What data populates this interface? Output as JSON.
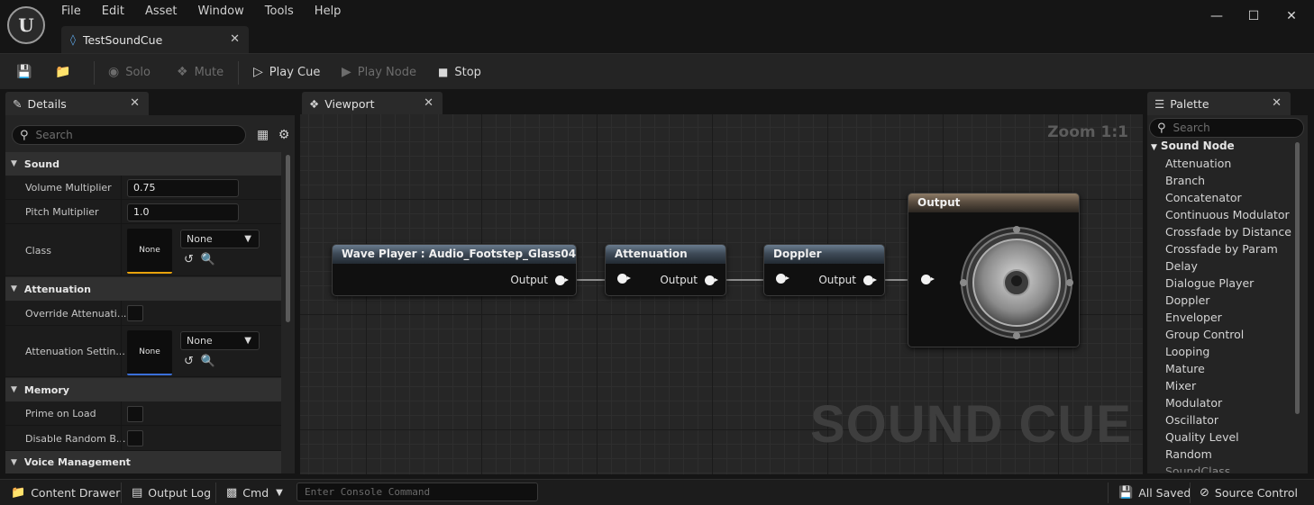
{
  "app": {
    "logo_text": "U",
    "menu": [
      "File",
      "Edit",
      "Asset",
      "Window",
      "Tools",
      "Help"
    ],
    "document_tab": "TestSoundCue"
  },
  "toolbar": {
    "solo": "Solo",
    "mute": "Mute",
    "play_cue": "Play Cue",
    "play_node": "Play Node",
    "stop": "Stop"
  },
  "details": {
    "tab_label": "Details",
    "search_placeholder": "Search",
    "categories": {
      "sound": "Sound",
      "attenuation": "Attenuation",
      "memory": "Memory",
      "voice": "Voice Management"
    },
    "props": {
      "volume_label": "Volume Multiplier",
      "volume_value": "0.75",
      "pitch_label": "Pitch Multiplier",
      "pitch_value": "1.0",
      "class_label": "Class",
      "class_thumb": "None",
      "class_combo": "None",
      "override_label": "Override Attenuati...",
      "att_settings_label": "Attenuation Settin...",
      "att_thumb": "None",
      "att_combo": "None",
      "prime_label": "Prime on Load",
      "disable_random_label": "Disable Random B..."
    }
  },
  "viewport": {
    "tab_label": "Viewport",
    "zoom": "Zoom 1:1",
    "watermark": "SOUND CUE",
    "nodes": {
      "wave_player": "Wave Player : Audio_Footstep_Glass04",
      "attenuation": "Attenuation",
      "doppler": "Doppler",
      "output": "Output",
      "pin_output": "Output"
    }
  },
  "palette": {
    "tab_label": "Palette",
    "search_placeholder": "Search",
    "root": "Sound Node",
    "items": [
      "Attenuation",
      "Branch",
      "Concatenator",
      "Continuous Modulator",
      "Crossfade by Distance",
      "Crossfade by Param",
      "Delay",
      "Dialogue Player",
      "Doppler",
      "Enveloper",
      "Group Control",
      "Looping",
      "Mature",
      "Mixer",
      "Modulator",
      "Oscillator",
      "Quality Level",
      "Random",
      "SoundClass"
    ]
  },
  "statusbar": {
    "content_drawer": "Content Drawer",
    "output_log": "Output Log",
    "cmd": "Cmd",
    "console_placeholder": "Enter Console Command",
    "all_saved": "All Saved",
    "source_control": "Source Control"
  },
  "colors": {
    "accent_class": "#e8a20c",
    "accent_attenuation": "#3a6fd8",
    "pin": "#f2f2f2",
    "wire": "#8c8c8c"
  },
  "icons": [
    "unreal-logo-icon",
    "save-icon",
    "browse-icon",
    "solo-icon",
    "mute-icon",
    "play-icon",
    "play-node-icon",
    "stop-icon",
    "search-icon",
    "table-view-icon",
    "settings-icon",
    "speaker-icon"
  ]
}
